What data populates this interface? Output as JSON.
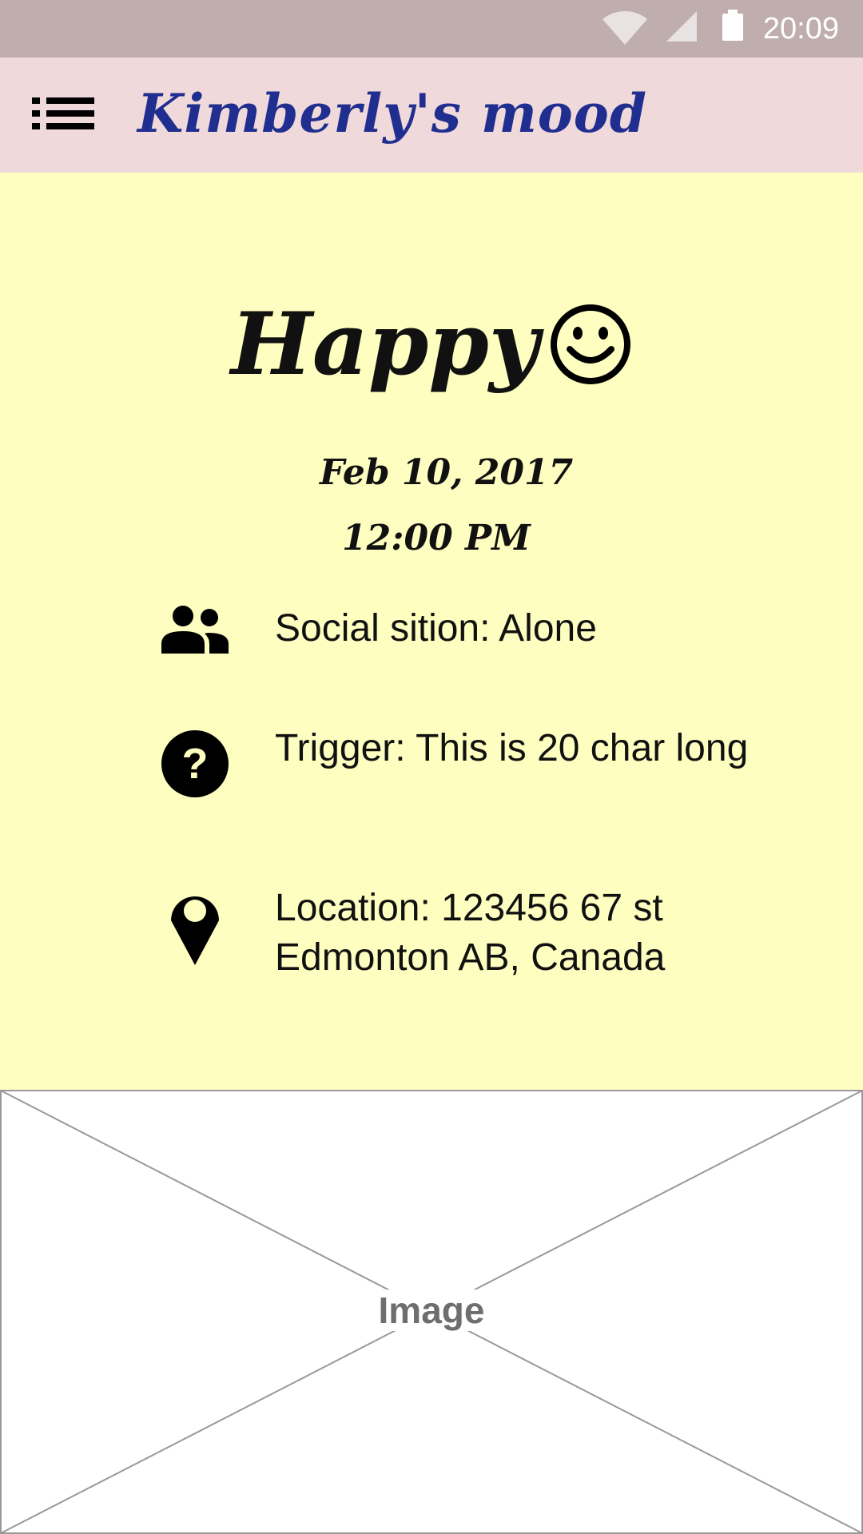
{
  "status_bar": {
    "time": "20:09",
    "icons": [
      "wifi-icon",
      "signal-icon",
      "battery-icon"
    ]
  },
  "app_bar": {
    "title": "Kimberly's mood",
    "menu_icon": "list-menu-icon"
  },
  "mood": {
    "label": "Happy",
    "icon": "smiley-face-icon",
    "date": "Feb 10, 2017",
    "time": "12:00 PM"
  },
  "details": {
    "social": "Social sition: Alone",
    "trigger": "Trigger: This is 20 char long",
    "location": "Location: 123456 67 st Edmonton AB, Canada"
  },
  "image": {
    "label": "Image"
  },
  "colors": {
    "status_bar": "#c0aeae",
    "app_bar": "#f0d9db",
    "title": "#1f2e8f",
    "content_bg": "#fefec0"
  }
}
